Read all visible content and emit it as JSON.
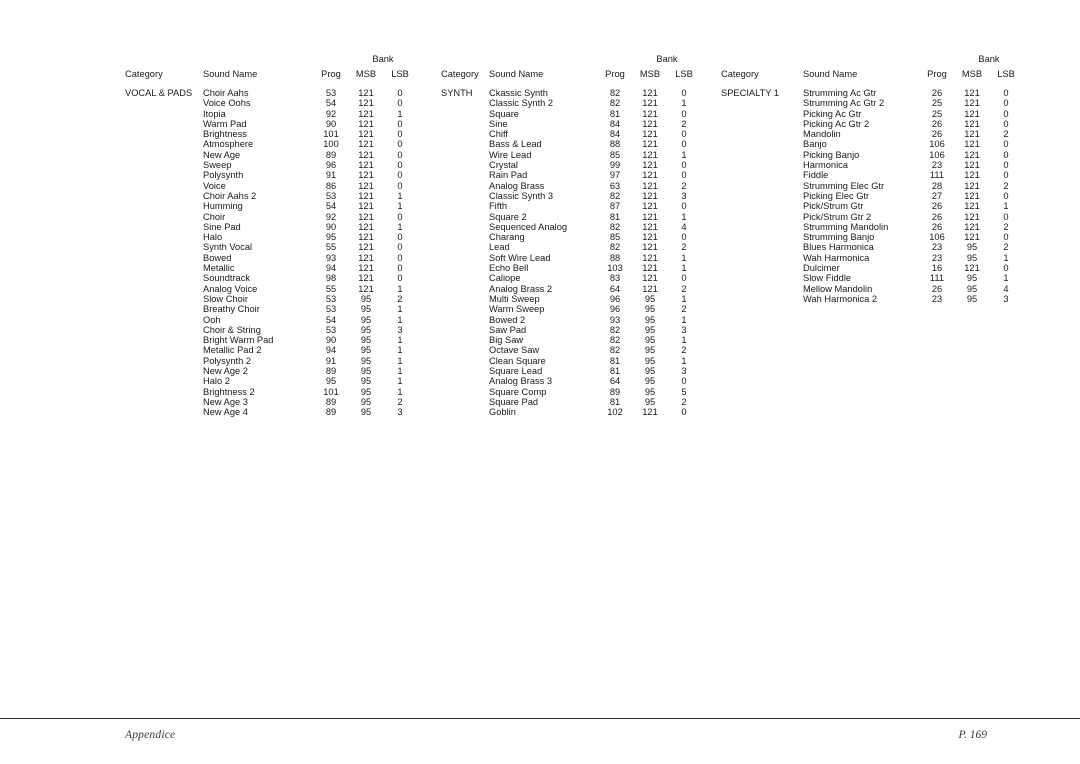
{
  "document": {
    "footer_left": "Appendice",
    "footer_right": "P. 169"
  },
  "headers": {
    "bank": "Bank",
    "category": "Category",
    "sound_name": "Sound Name",
    "prog": "Prog",
    "msb": "MSB",
    "lsb": "LSB"
  },
  "groups": [
    {
      "category": "VOCAL & PADS",
      "rows": [
        {
          "name": "Choir Aahs",
          "prog": "53",
          "msb": "121",
          "lsb": "0"
        },
        {
          "name": "Voice Oohs",
          "prog": "54",
          "msb": "121",
          "lsb": "0"
        },
        {
          "name": "Itopia",
          "prog": "92",
          "msb": "121",
          "lsb": "1"
        },
        {
          "name": "Warm Pad",
          "prog": "90",
          "msb": "121",
          "lsb": "0"
        },
        {
          "name": "Brightness",
          "prog": "101",
          "msb": "121",
          "lsb": "0"
        },
        {
          "name": "Atmosphere",
          "prog": "100",
          "msb": "121",
          "lsb": "0"
        },
        {
          "name": "New Age",
          "prog": "89",
          "msb": "121",
          "lsb": "0"
        },
        {
          "name": "Sweep",
          "prog": "96",
          "msb": "121",
          "lsb": "0"
        },
        {
          "name": "Polysynth",
          "prog": "91",
          "msb": "121",
          "lsb": "0"
        },
        {
          "name": "Voice",
          "prog": "86",
          "msb": "121",
          "lsb": "0"
        },
        {
          "name": "Choir Aahs 2",
          "prog": "53",
          "msb": "121",
          "lsb": "1"
        },
        {
          "name": "Humming",
          "prog": "54",
          "msb": "121",
          "lsb": "1"
        },
        {
          "name": "Choir",
          "prog": "92",
          "msb": "121",
          "lsb": "0"
        },
        {
          "name": "Sine Pad",
          "prog": "90",
          "msb": "121",
          "lsb": "1"
        },
        {
          "name": "Halo",
          "prog": "95",
          "msb": "121",
          "lsb": "0"
        },
        {
          "name": "Synth Vocal",
          "prog": "55",
          "msb": "121",
          "lsb": "0"
        },
        {
          "name": "Bowed",
          "prog": "93",
          "msb": "121",
          "lsb": "0"
        },
        {
          "name": "Metallic",
          "prog": "94",
          "msb": "121",
          "lsb": "0"
        },
        {
          "name": "Soundtrack",
          "prog": "98",
          "msb": "121",
          "lsb": "0"
        },
        {
          "name": "Analog Voice",
          "prog": "55",
          "msb": "121",
          "lsb": "1"
        },
        {
          "name": "Slow Choir",
          "prog": "53",
          "msb": "95",
          "lsb": "2"
        },
        {
          "name": "Breathy Choir",
          "prog": "53",
          "msb": "95",
          "lsb": "1"
        },
        {
          "name": "Ooh",
          "prog": "54",
          "msb": "95",
          "lsb": "1"
        },
        {
          "name": "Choir & String",
          "prog": "53",
          "msb": "95",
          "lsb": "3"
        },
        {
          "name": "Bright Warm Pad",
          "prog": "90",
          "msb": "95",
          "lsb": "1"
        },
        {
          "name": "Metallic Pad 2",
          "prog": "94",
          "msb": "95",
          "lsb": "1"
        },
        {
          "name": "Polysynth 2",
          "prog": "91",
          "msb": "95",
          "lsb": "1"
        },
        {
          "name": "New Age 2",
          "prog": "89",
          "msb": "95",
          "lsb": "1"
        },
        {
          "name": "Halo 2",
          "prog": "95",
          "msb": "95",
          "lsb": "1"
        },
        {
          "name": "Brightness 2",
          "prog": "101",
          "msb": "95",
          "lsb": "1"
        },
        {
          "name": "New Age 3",
          "prog": "89",
          "msb": "95",
          "lsb": "2"
        },
        {
          "name": "New Age 4",
          "prog": "89",
          "msb": "95",
          "lsb": "3"
        }
      ]
    },
    {
      "category": "SYNTH",
      "rows": [
        {
          "name": "Ckassic Synth",
          "prog": "82",
          "msb": "121",
          "lsb": "0"
        },
        {
          "name": "Classic Synth 2",
          "prog": "82",
          "msb": "121",
          "lsb": "1"
        },
        {
          "name": "Square",
          "prog": "81",
          "msb": "121",
          "lsb": "0"
        },
        {
          "name": "Sine",
          "prog": "84",
          "msb": "121",
          "lsb": "2"
        },
        {
          "name": "Chiff",
          "prog": "84",
          "msb": "121",
          "lsb": "0"
        },
        {
          "name": "Bass & Lead",
          "prog": "88",
          "msb": "121",
          "lsb": "0"
        },
        {
          "name": "Wire Lead",
          "prog": "85",
          "msb": "121",
          "lsb": "1"
        },
        {
          "name": "Crystal",
          "prog": "99",
          "msb": "121",
          "lsb": "0"
        },
        {
          "name": "Rain Pad",
          "prog": "97",
          "msb": "121",
          "lsb": "0"
        },
        {
          "name": "Analog Brass",
          "prog": "63",
          "msb": "121",
          "lsb": "2"
        },
        {
          "name": "Classic Synth 3",
          "prog": "82",
          "msb": "121",
          "lsb": "3"
        },
        {
          "name": "Fifth",
          "prog": "87",
          "msb": "121",
          "lsb": "0"
        },
        {
          "name": "Square 2",
          "prog": "81",
          "msb": "121",
          "lsb": "1"
        },
        {
          "name": "Sequenced Analog",
          "prog": "82",
          "msb": "121",
          "lsb": "4"
        },
        {
          "name": "Charang",
          "prog": "85",
          "msb": "121",
          "lsb": "0"
        },
        {
          "name": "Lead",
          "prog": "82",
          "msb": "121",
          "lsb": "2"
        },
        {
          "name": "Soft Wire Lead",
          "prog": "88",
          "msb": "121",
          "lsb": "1"
        },
        {
          "name": "Echo Bell",
          "prog": "103",
          "msb": "121",
          "lsb": "1"
        },
        {
          "name": "Caliope",
          "prog": "83",
          "msb": "121",
          "lsb": "0"
        },
        {
          "name": "Analog Brass 2",
          "prog": "64",
          "msb": "121",
          "lsb": "2"
        },
        {
          "name": "Multi Sweep",
          "prog": "96",
          "msb": "95",
          "lsb": "1"
        },
        {
          "name": "Warm Sweep",
          "prog": "96",
          "msb": "95",
          "lsb": "2"
        },
        {
          "name": "Bowed 2",
          "prog": "93",
          "msb": "95",
          "lsb": "1"
        },
        {
          "name": "Saw Pad",
          "prog": "82",
          "msb": "95",
          "lsb": "3"
        },
        {
          "name": "Big Saw",
          "prog": "82",
          "msb": "95",
          "lsb": "1"
        },
        {
          "name": "Octave Saw",
          "prog": "82",
          "msb": "95",
          "lsb": "2"
        },
        {
          "name": "Clean Square",
          "prog": "81",
          "msb": "95",
          "lsb": "1"
        },
        {
          "name": "Square Lead",
          "prog": "81",
          "msb": "95",
          "lsb": "3"
        },
        {
          "name": "Analog Brass 3",
          "prog": "64",
          "msb": "95",
          "lsb": "0"
        },
        {
          "name": "Square Comp",
          "prog": "89",
          "msb": "95",
          "lsb": "5"
        },
        {
          "name": "Square Pad",
          "prog": "81",
          "msb": "95",
          "lsb": "2"
        },
        {
          "name": "Goblin",
          "prog": "102",
          "msb": "121",
          "lsb": "0"
        }
      ]
    },
    {
      "category": "SPECIALTY 1",
      "rows": [
        {
          "name": "Strumming Ac Gtr",
          "prog": "26",
          "msb": "121",
          "lsb": "0"
        },
        {
          "name": "Strumming Ac Gtr 2",
          "prog": "25",
          "msb": "121",
          "lsb": "0"
        },
        {
          "name": "Picking Ac Gtr",
          "prog": "25",
          "msb": "121",
          "lsb": "0"
        },
        {
          "name": "Picking Ac Gtr 2",
          "prog": "26",
          "msb": "121",
          "lsb": "0"
        },
        {
          "name": "Mandolin",
          "prog": "26",
          "msb": "121",
          "lsb": "2"
        },
        {
          "name": "Banjo",
          "prog": "106",
          "msb": "121",
          "lsb": "0"
        },
        {
          "name": "Picking Banjo",
          "prog": "106",
          "msb": "121",
          "lsb": "0"
        },
        {
          "name": "Harmonica",
          "prog": "23",
          "msb": "121",
          "lsb": "0"
        },
        {
          "name": "Fiddle",
          "prog": "111",
          "msb": "121",
          "lsb": "0"
        },
        {
          "name": "Strumming Elec Gtr",
          "prog": "28",
          "msb": "121",
          "lsb": "2"
        },
        {
          "name": "Picking Elec Gtr",
          "prog": "27",
          "msb": "121",
          "lsb": "0"
        },
        {
          "name": "Pick/Strum Gtr",
          "prog": "26",
          "msb": "121",
          "lsb": "1"
        },
        {
          "name": "Pick/Strum Gtr 2",
          "prog": "26",
          "msb": "121",
          "lsb": "0"
        },
        {
          "name": "Strumming Mandolin",
          "prog": "26",
          "msb": "121",
          "lsb": "2"
        },
        {
          "name": "Strumming Banjo",
          "prog": "106",
          "msb": "121",
          "lsb": "0"
        },
        {
          "name": "Blues Harmonica",
          "prog": "23",
          "msb": "95",
          "lsb": "2"
        },
        {
          "name": "Wah Harmonica",
          "prog": "23",
          "msb": "95",
          "lsb": "1"
        },
        {
          "name": "Dulcimer",
          "prog": "16",
          "msb": "121",
          "lsb": "0"
        },
        {
          "name": "Slow Fiddle",
          "prog": "111",
          "msb": "95",
          "lsb": "1"
        },
        {
          "name": "Mellow Mandolin",
          "prog": "26",
          "msb": "95",
          "lsb": "4"
        },
        {
          "name": "Wah Harmonica 2",
          "prog": "23",
          "msb": "95",
          "lsb": "3"
        }
      ]
    }
  ]
}
